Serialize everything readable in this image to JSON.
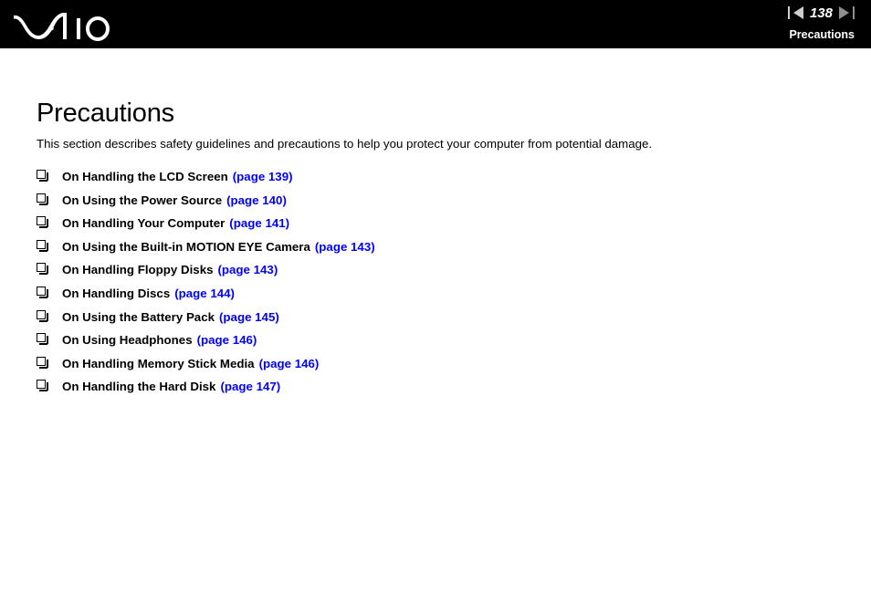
{
  "header": {
    "logo_name": "vaio-logo",
    "logo_text": "VAIO",
    "nav": {
      "prev_icon": "triangle-left-icon",
      "next_icon": "triangle-right-icon",
      "page_number": "138"
    },
    "section_label": "Precautions",
    "background_color": "#000000",
    "text_color": "#ffffff",
    "prev_arrow_color": "#cfcfcf",
    "next_arrow_color": "#8f8f8f"
  },
  "main": {
    "title": "Precautions",
    "intro": "This section describes safety guidelines and precautions to help you protect your computer from potential damage.",
    "link_color": "#0000ff",
    "bullet_icon": "hollow-square-bullet-icon",
    "toc_items": [
      {
        "label": "On Handling the LCD Screen",
        "page_ref": "(page 139)"
      },
      {
        "label": "On Using the Power Source",
        "page_ref": "(page 140)"
      },
      {
        "label": "On Handling Your Computer",
        "page_ref": "(page 141)"
      },
      {
        "label": "On Using the Built-in MOTION EYE Camera",
        "page_ref": "(page 143)"
      },
      {
        "label": "On Handling Floppy Disks",
        "page_ref": "(page 143)"
      },
      {
        "label": "On Handling Discs",
        "page_ref": "(page 144)"
      },
      {
        "label": "On Using the Battery Pack",
        "page_ref": "(page 145)"
      },
      {
        "label": "On Using Headphones",
        "page_ref": "(page 146)"
      },
      {
        "label": "On Handling Memory Stick Media",
        "page_ref": "(page 146)"
      },
      {
        "label": "On Handling the Hard Disk",
        "page_ref": "(page 147)"
      }
    ]
  }
}
